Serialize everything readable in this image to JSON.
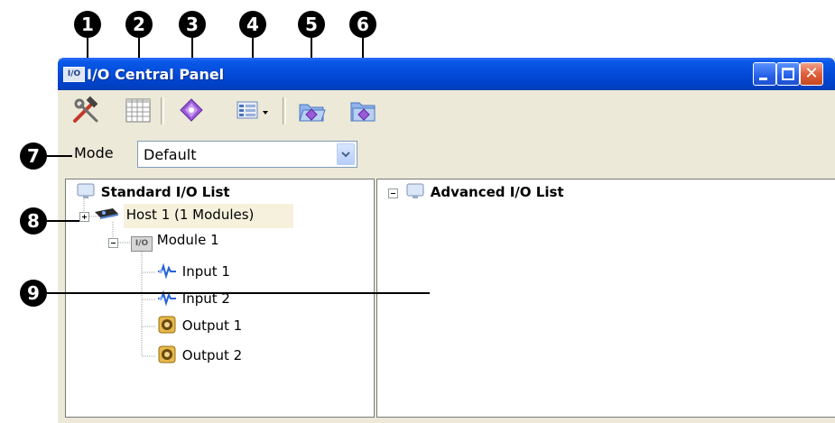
{
  "callouts": [
    "1",
    "2",
    "3",
    "4",
    "5",
    "6",
    "7",
    "8",
    "9"
  ],
  "window": {
    "title": "I/O Central Panel",
    "app_icon_text": "I/O"
  },
  "toolbar": {
    "buttons": [
      {
        "name": "settings-tools",
        "icon": "hammer-wrench-icon"
      },
      {
        "name": "grid-view",
        "icon": "grid-table-icon"
      },
      {
        "name": "add-io",
        "icon": "purple-diamond-icon"
      },
      {
        "name": "view-options",
        "icon": "list-view-dropdown-icon"
      },
      {
        "name": "import",
        "icon": "folder-import-icon"
      },
      {
        "name": "export",
        "icon": "folder-export-icon"
      }
    ]
  },
  "mode": {
    "label": "Mode",
    "selected": "Default"
  },
  "standard_list": {
    "title": "Standard I/O List",
    "host": "Host 1 (1 Modules)",
    "module": "Module 1",
    "module_icon_text": "I/O",
    "items": [
      "Input 1",
      "Input 2",
      "Output 1",
      "Output 2"
    ]
  },
  "advanced_list": {
    "title": "Advanced I/O List"
  },
  "colors": {
    "titlebar": "#0249d6",
    "window_bg": "#ECE9D8",
    "callout": "#000000",
    "host_highlight": "#f6f1dd"
  }
}
